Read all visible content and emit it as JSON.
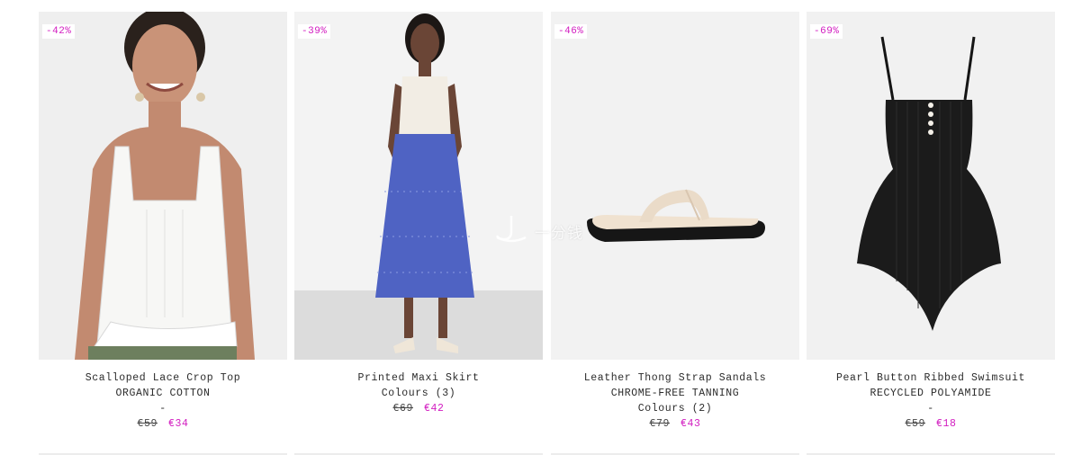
{
  "products": [
    {
      "discount": "-42%",
      "name": "Scalloped Lace Crop Top",
      "material": "ORGANIC COTTON",
      "colours": "",
      "dash": "-",
      "old_price": "€59",
      "new_price": "€34",
      "image": "woman-white-lace-crop-top"
    },
    {
      "discount": "-39%",
      "name": "Printed Maxi Skirt",
      "material": "",
      "colours": "Colours (3)",
      "dash": "",
      "old_price": "€69",
      "new_price": "€42",
      "image": "woman-blue-floral-maxi-skirt"
    },
    {
      "discount": "-46%",
      "name": "Leather Thong Strap Sandals",
      "material": "CHROME-FREE TANNING",
      "colours": "Colours (2)",
      "dash": "",
      "old_price": "€79",
      "new_price": "€43",
      "image": "cream-leather-thong-sandal"
    },
    {
      "discount": "-69%",
      "name": "Pearl Button Ribbed Swimsuit",
      "material": "RECYCLED POLYAMIDE",
      "colours": "",
      "dash": "-",
      "old_price": "€59",
      "new_price": "€18",
      "image": "black-ribbed-swimsuit"
    }
  ],
  "watermark": {
    "text": "一分钱"
  },
  "colors": {
    "sale_accent": "#d21cc0",
    "text": "#2b2b2b",
    "background": "#ffffff"
  }
}
